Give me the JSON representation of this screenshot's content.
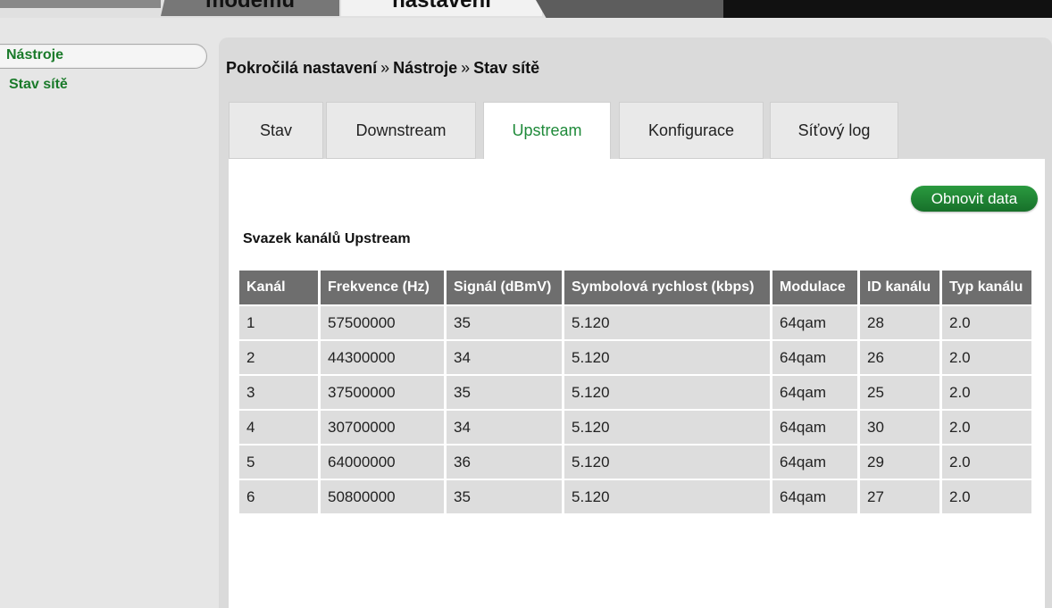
{
  "topnav": {
    "tabs": [
      {
        "label": "modemu"
      },
      {
        "label": "nastavení"
      }
    ]
  },
  "sidebar": {
    "selected": "Nástroje",
    "sub_item": "Stav sítě"
  },
  "breadcrumb": {
    "items": [
      "Pokročilá nastavení",
      "Nástroje",
      "Stav sítě"
    ],
    "separator": "»"
  },
  "tabs": [
    {
      "label": "Stav"
    },
    {
      "label": "Downstream"
    },
    {
      "label": "Upstream",
      "active": true
    },
    {
      "label": "Konfigurace"
    },
    {
      "label": "Síťový log"
    }
  ],
  "refresh_button": "Obnovit data",
  "section_title": "Svazek kanálů Upstream",
  "table": {
    "columns": [
      "Kanál",
      "Frekvence (Hz)",
      "Signál (dBmV)",
      "Symbolová rychlost (kbps)",
      "Modulace",
      "ID kanálu",
      "Typ kanálu"
    ],
    "rows": [
      [
        "1",
        "57500000",
        "35",
        "5.120",
        "64qam",
        "28",
        "2.0"
      ],
      [
        "2",
        "44300000",
        "34",
        "5.120",
        "64qam",
        "26",
        "2.0"
      ],
      [
        "3",
        "37500000",
        "35",
        "5.120",
        "64qam",
        "25",
        "2.0"
      ],
      [
        "4",
        "30700000",
        "34",
        "5.120",
        "64qam",
        "30",
        "2.0"
      ],
      [
        "5",
        "64000000",
        "36",
        "5.120",
        "64qam",
        "29",
        "2.0"
      ],
      [
        "6",
        "50800000",
        "35",
        "5.120",
        "64qam",
        "27",
        "2.0"
      ]
    ]
  },
  "colors": {
    "accent_green": "#1f8a3a",
    "header_gray": "#6e6e6e",
    "cell_gray": "#dddddd"
  }
}
